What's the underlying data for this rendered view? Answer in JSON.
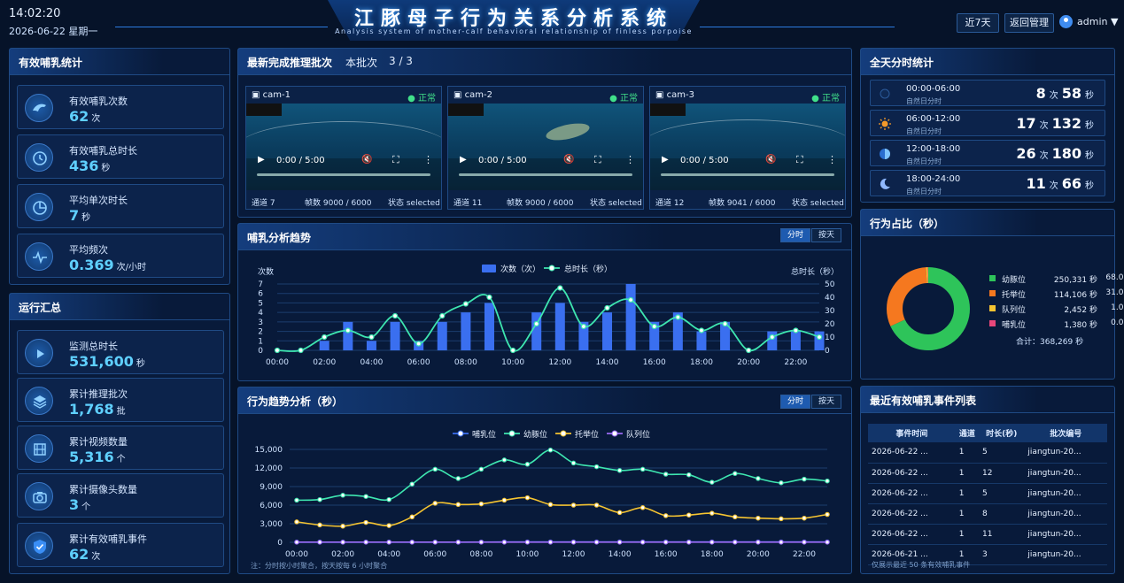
{
  "header": {
    "time": "14:02:20",
    "date": "2026-06-22 星期一",
    "title": "江豚母子行为关系分析系统",
    "subtitle": "Analysis system of mother-calf behavioral relationship of finless porpoise",
    "btn_range": "近7天",
    "btn_back": "返回管理",
    "user": "admin",
    "colors": {
      "accent": "#2d7be0",
      "cyan": "#5fd0ff",
      "ok": "#40e08a"
    }
  },
  "nursing_stats": {
    "title": "有效哺乳统计",
    "items": [
      {
        "icon": "dolphin-icon",
        "label": "有效哺乳次数",
        "value": "62",
        "unit": "次"
      },
      {
        "icon": "clock-icon",
        "label": "有效哺乳总时长",
        "value": "436",
        "unit": "秒"
      },
      {
        "icon": "pie-icon",
        "label": "平均单次时长",
        "value": "7",
        "unit": "秒"
      },
      {
        "icon": "pulse-icon",
        "label": "平均频次",
        "value": "0.369",
        "unit": "次/小时"
      }
    ]
  },
  "run_summary": {
    "title": "运行汇总",
    "items": [
      {
        "icon": "play-icon",
        "label": "监测总时长",
        "value": "531,600",
        "unit": "秒"
      },
      {
        "icon": "layers-icon",
        "label": "累计推理批次",
        "value": "1,768",
        "unit": "批"
      },
      {
        "icon": "film-icon",
        "label": "累计视频数量",
        "value": "5,316",
        "unit": "个"
      },
      {
        "icon": "camera-icon",
        "label": "累计摄像头数量",
        "value": "3",
        "unit": "个"
      },
      {
        "icon": "shield-check-icon",
        "label": "累计有效哺乳事件",
        "value": "62",
        "unit": "次"
      }
    ]
  },
  "batch": {
    "title": "最新完成推理批次",
    "label": "本批次",
    "count": "3 / 3",
    "cams": [
      {
        "name": "cam-1",
        "status": "正常",
        "time": "0:00 / 5:00",
        "channel": "通道 7",
        "frames": "帧数 9000 / 6000",
        "state": "状态 selected"
      },
      {
        "name": "cam-2",
        "status": "正常",
        "time": "0:00 / 5:00",
        "channel": "通道 11",
        "frames": "帧数 9000 / 6000",
        "state": "状态 selected"
      },
      {
        "name": "cam-3",
        "status": "正常",
        "time": "0:00 / 5:00",
        "channel": "通道 12",
        "frames": "帧数 9041 / 6000",
        "state": "状态 selected"
      }
    ]
  },
  "nursing_trend": {
    "title": "哺乳分析趋势",
    "toggle": [
      "分时",
      "按天"
    ],
    "chart_data": {
      "type": "bar",
      "x": [
        "00:00",
        "01:00",
        "02:00",
        "03:00",
        "04:00",
        "05:00",
        "06:00",
        "07:00",
        "08:00",
        "09:00",
        "10:00",
        "11:00",
        "12:00",
        "13:00",
        "14:00",
        "15:00",
        "16:00",
        "17:00",
        "18:00",
        "19:00",
        "20:00",
        "21:00",
        "22:00",
        "23:00"
      ],
      "xticks": [
        "00:00",
        "02:00",
        "04:00",
        "06:00",
        "08:00",
        "10:00",
        "12:00",
        "14:00",
        "16:00",
        "18:00",
        "20:00",
        "22:00"
      ],
      "series": [
        {
          "name": "次数（次）",
          "type": "bar",
          "color": "#3a6ff0",
          "axis": "left",
          "values": [
            0,
            0,
            1,
            3,
            1,
            3,
            1,
            3,
            4,
            5,
            0,
            4,
            5,
            3,
            4,
            7,
            3,
            4,
            2,
            3,
            0,
            2,
            2,
            2
          ]
        },
        {
          "name": "总时长（秒）",
          "type": "line",
          "color": "#3ee6b0",
          "axis": "right",
          "values": [
            0,
            0,
            10,
            15,
            10,
            26,
            5,
            26,
            35,
            40,
            0,
            20,
            47,
            18,
            32,
            38,
            18,
            25,
            15,
            20,
            0,
            10,
            15,
            10
          ]
        }
      ],
      "ylabel_left": "次数",
      "ylabel_right": "总时长（秒）",
      "ylim_left": [
        0,
        7
      ],
      "yticks_left": [
        0,
        1,
        2,
        3,
        4,
        5,
        6,
        7
      ],
      "ylim_right": [
        0,
        50
      ],
      "yticks_right": [
        0,
        10,
        20,
        30,
        40,
        50
      ],
      "grid": true,
      "legend": "top-center"
    }
  },
  "behavior_trend": {
    "title": "行为趋势分析（秒）",
    "toggle": [
      "分时",
      "按天"
    ],
    "note": "注：分时按小时聚合，按天按每 6 小时聚合",
    "chart_data": {
      "type": "line",
      "x": [
        "00:00",
        "01:00",
        "02:00",
        "03:00",
        "04:00",
        "05:00",
        "06:00",
        "07:00",
        "08:00",
        "09:00",
        "10:00",
        "11:00",
        "12:00",
        "13:00",
        "14:00",
        "15:00",
        "16:00",
        "17:00",
        "18:00",
        "19:00",
        "20:00",
        "21:00",
        "22:00",
        "23:00"
      ],
      "xticks": [
        "00:00",
        "02:00",
        "04:00",
        "06:00",
        "08:00",
        "10:00",
        "12:00",
        "14:00",
        "16:00",
        "18:00",
        "20:00",
        "22:00"
      ],
      "series": [
        {
          "name": "哺乳位",
          "color": "#3a6ff0",
          "values": [
            30,
            30,
            30,
            30,
            30,
            30,
            30,
            30,
            40,
            60,
            60,
            60,
            60,
            60,
            60,
            60,
            60,
            60,
            60,
            60,
            60,
            60,
            60,
            60
          ]
        },
        {
          "name": "幼豚位",
          "color": "#3ee6b0",
          "values": [
            6800,
            6900,
            7600,
            7400,
            6900,
            9400,
            11800,
            10300,
            11800,
            13300,
            12600,
            14900,
            12800,
            12200,
            11600,
            11800,
            11000,
            10900,
            9700,
            11100,
            10300,
            9600,
            10200,
            9900
          ]
        },
        {
          "name": "托举位",
          "color": "#f5c431",
          "values": [
            3300,
            2800,
            2600,
            3200,
            2700,
            4100,
            6300,
            6100,
            6200,
            6800,
            7200,
            6100,
            6000,
            6000,
            4800,
            5600,
            4300,
            4400,
            4700,
            4100,
            3900,
            3800,
            3900,
            4500
          ]
        },
        {
          "name": "队列位",
          "color": "#9b6bf5",
          "values": [
            20,
            20,
            20,
            20,
            20,
            20,
            20,
            20,
            20,
            20,
            20,
            20,
            20,
            20,
            20,
            20,
            20,
            20,
            20,
            20,
            20,
            20,
            20,
            20
          ]
        }
      ],
      "ylim": [
        0,
        15000
      ],
      "yticks": [
        "0",
        "3,000",
        "6,000",
        "9,000",
        "12,000",
        "15,000"
      ],
      "grid": true,
      "legend": "top-center"
    }
  },
  "period_stats": {
    "title": "全天分时统计",
    "items": [
      {
        "icon": "moon-dark-icon",
        "range": "00:00-06:00",
        "sub": "自然日分时",
        "count": "8",
        "count_unit": "次",
        "secs": "58",
        "secs_unit": "秒"
      },
      {
        "icon": "sun-icon",
        "range": "06:00-12:00",
        "sub": "自然日分时",
        "count": "17",
        "count_unit": "次",
        "secs": "132",
        "secs_unit": "秒"
      },
      {
        "icon": "half-moon-icon",
        "range": "12:00-18:00",
        "sub": "自然日分时",
        "count": "26",
        "count_unit": "次",
        "secs": "180",
        "secs_unit": "秒"
      },
      {
        "icon": "crescent-icon",
        "range": "18:00-24:00",
        "sub": "自然日分时",
        "count": "11",
        "count_unit": "次",
        "secs": "66",
        "secs_unit": "秒"
      }
    ]
  },
  "behavior_share": {
    "title": "行为占比（秒）",
    "chart_data": {
      "type": "pie",
      "slices": [
        {
          "name": "幼豚位",
          "value": 250331,
          "label": "250,331 秒",
          "pct": "68.0%",
          "color": "#2ec45a"
        },
        {
          "name": "托举位",
          "value": 114106,
          "label": "114,106 秒",
          "pct": "31.0%",
          "color": "#f5781f"
        },
        {
          "name": "队列位",
          "value": 2452,
          "label": "2,452 秒",
          "pct": "1.0%",
          "color": "#f5c431"
        },
        {
          "name": "哺乳位",
          "value": 1380,
          "label": "1,380 秒",
          "pct": "0.0%",
          "color": "#e8477a"
        }
      ],
      "total": "合计：368,269 秒",
      "legend": "right"
    }
  },
  "events": {
    "title": "最近有效哺乳事件列表",
    "columns": [
      "事件时间",
      "通道",
      "时长(秒)",
      "批次编号"
    ],
    "rows": [
      [
        "2026-06-22 ...",
        "1",
        "5",
        "jiangtun-20..."
      ],
      [
        "2026-06-22 ...",
        "1",
        "12",
        "jiangtun-20..."
      ],
      [
        "2026-06-22 ...",
        "1",
        "5",
        "jiangtun-20..."
      ],
      [
        "2026-06-22 ...",
        "1",
        "8",
        "jiangtun-20..."
      ],
      [
        "2026-06-22 ...",
        "1",
        "11",
        "jiangtun-20..."
      ],
      [
        "2026-06-21 ...",
        "1",
        "3",
        "jiangtun-20..."
      ]
    ],
    "note": "仅展示最近 50 条有效哺乳事件"
  }
}
